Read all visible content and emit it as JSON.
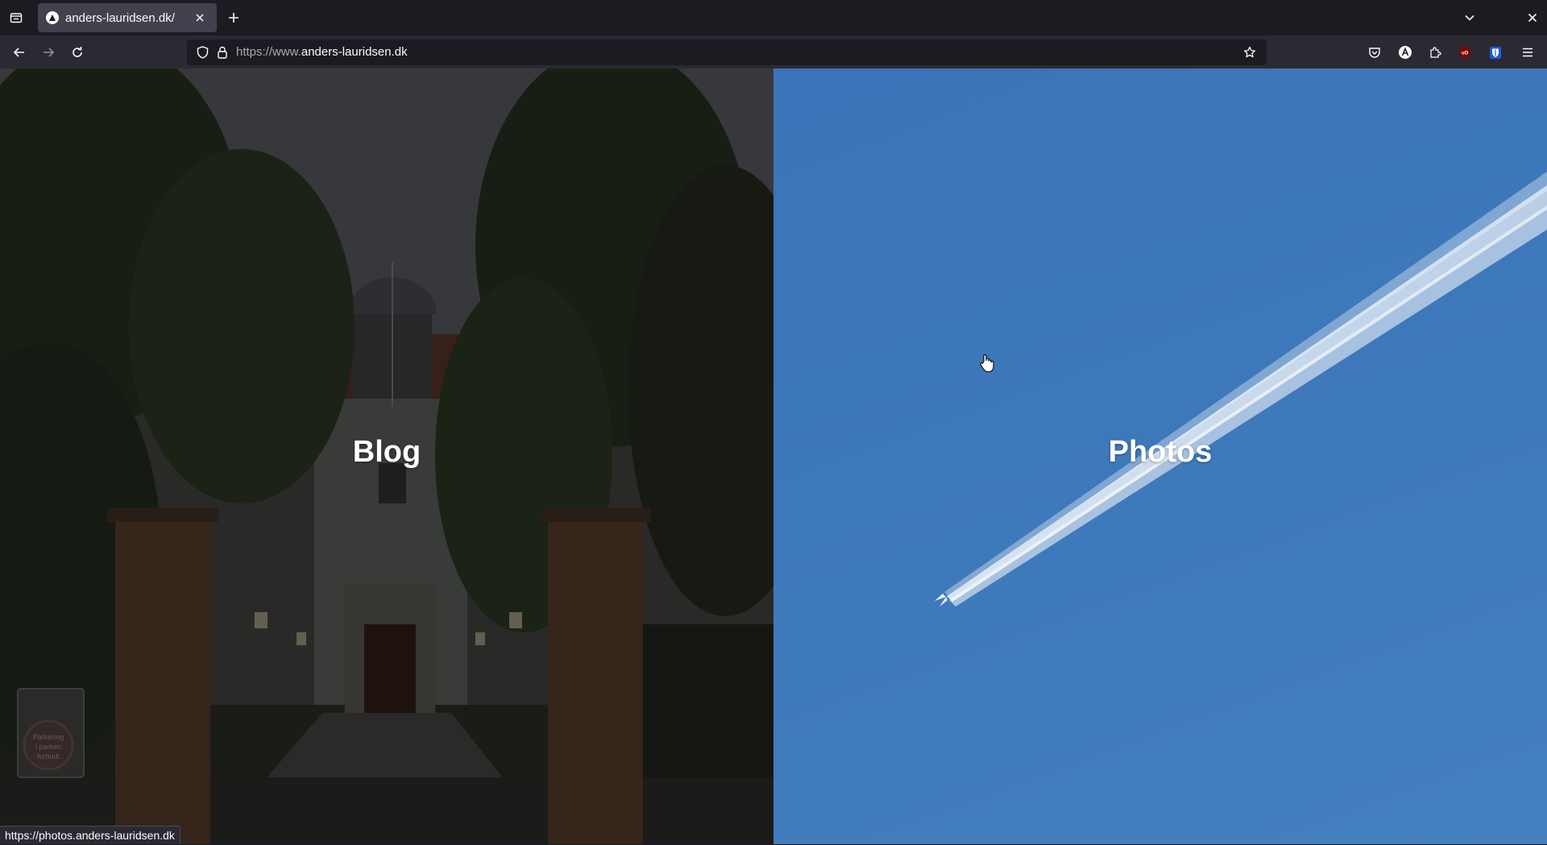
{
  "browser": {
    "tab": {
      "title": "anders-lauridsen.dk/",
      "favicon": "triangle-favicon-icon"
    },
    "urlbar": {
      "url_prefix": "https://www.",
      "url_domain": "anders-lauridsen.dk"
    },
    "icons": {
      "list_all_tabs": "tabs-list-icon",
      "new_tab": "plus-icon",
      "tab_close": "close-icon",
      "overflow": "chevron-down-icon",
      "window_close": "close-icon",
      "back": "back-arrow-icon",
      "forward": "forward-arrow-icon",
      "reload": "reload-icon",
      "tracking_protection": "shield-icon",
      "secure": "lock-icon",
      "bookmark": "star-icon",
      "pocket": "pocket-icon",
      "account": "account-icon",
      "extensions": "puzzle-icon",
      "ublock": "ublock-icon",
      "bitwarden": "bitwarden-icon",
      "menu": "hamburger-menu-icon"
    },
    "status_url": "https://photos.anders-lauridsen.dk"
  },
  "page": {
    "blog_label": "Blog",
    "photos_label": "Photos",
    "sign_text_line1": "Parkering",
    "sign_text_line2": "i parken",
    "sign_text_line3": "forbudt",
    "colors": {
      "sky_blue": "#3d78ba",
      "dark_overlay": "#2a2c27"
    }
  }
}
